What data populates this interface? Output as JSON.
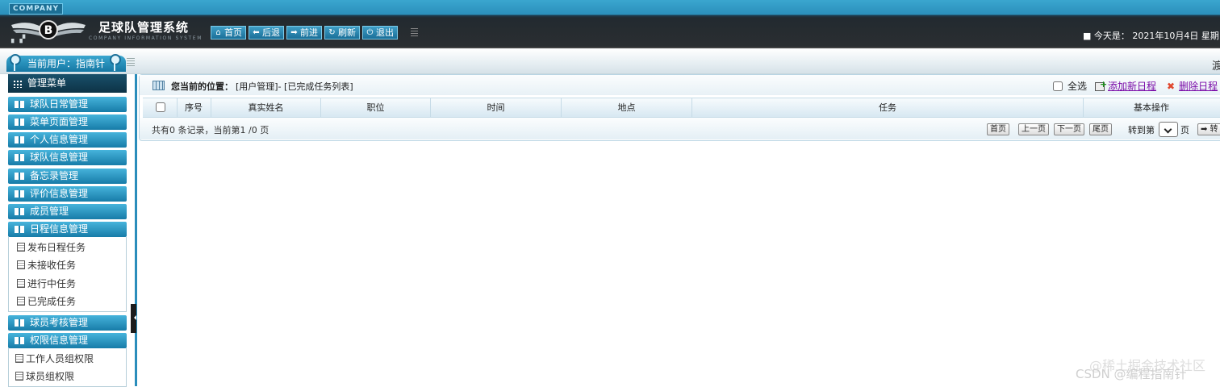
{
  "header": {
    "company_tag": "COMPANY",
    "title": "足球队管理系统",
    "subtitle": "COMPANY INFORMATION SYSTEM",
    "nav": [
      {
        "label": "首页",
        "icon": "home-icon"
      },
      {
        "label": "后退",
        "icon": "arrow-left-icon"
      },
      {
        "label": "前进",
        "icon": "arrow-right-icon"
      },
      {
        "label": "刷新",
        "icon": "refresh-icon"
      },
      {
        "label": "退出",
        "icon": "power-icon"
      }
    ],
    "date_text": "■ 今天是： 2021年10月4日 星期"
  },
  "subbar": {
    "current_user": "当前用户：指南针",
    "right_cut": "渡"
  },
  "sidebar": {
    "menu_title": "管理菜单",
    "sections": [
      {
        "label": "球队日常管理"
      },
      {
        "label": "菜单页面管理"
      },
      {
        "label": "个人信息管理"
      },
      {
        "label": "球队信息管理"
      },
      {
        "label": "备忘录管理"
      },
      {
        "label": "评价信息管理"
      },
      {
        "label": "成员管理"
      },
      {
        "label": "日程信息管理",
        "items": [
          "发布日程任务",
          "未接收任务",
          "进行中任务",
          "已完成任务"
        ]
      },
      {
        "label": "球员考核管理"
      },
      {
        "label": "权限信息管理",
        "items": [
          "工作人员组权限",
          "球员组权限"
        ]
      }
    ]
  },
  "main": {
    "location_label": "您当前的位置：",
    "location_value": "[用户管理]- [已完成任务列表]",
    "select_all": "全选",
    "add_link": "添加新日程",
    "delete_link": "删除日程",
    "columns": [
      "序号",
      "真实姓名",
      "职位",
      "时间",
      "地点",
      "任务",
      "基本操作"
    ],
    "rows": [],
    "record_text": "共有0 条记录，当前第1 /0 页",
    "pager": {
      "first": "首页",
      "prev": "上一页",
      "next": "下一页",
      "last": "尾页",
      "goto_label": "转到第",
      "page_unit": "页",
      "goto_button": "➡ 转"
    }
  },
  "watermark": {
    "line1": "@稀土掘金技术社区",
    "line2": "CSDN @编程指南针"
  },
  "colors": {
    "header_dark": "#2b2e31",
    "accent_blue": "#1b7fac",
    "link_purple": "#7a0ca8",
    "delete_red": "#e0482f"
  }
}
